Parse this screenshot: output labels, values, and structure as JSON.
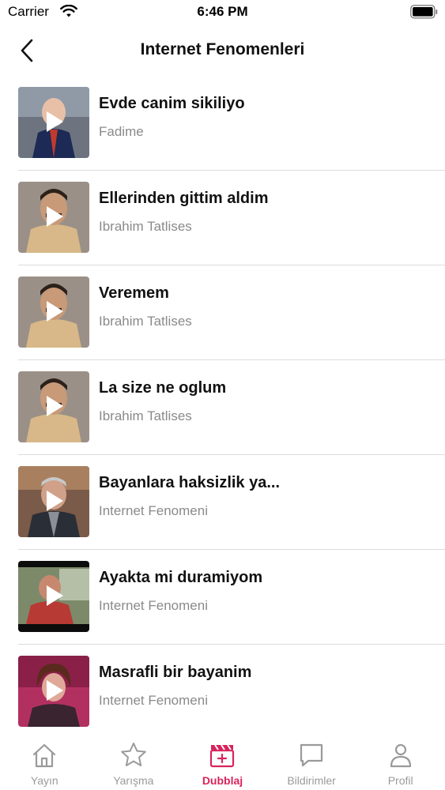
{
  "status": {
    "carrier": "Carrier",
    "time": "6:46 PM"
  },
  "nav": {
    "title": "Internet Fenomenleri"
  },
  "items": [
    {
      "title": "Evde canim sikiliyo",
      "subtitle": "Fadime"
    },
    {
      "title": "Ellerinden gittim aldim",
      "subtitle": "Ibrahim Tatlises"
    },
    {
      "title": "Veremem",
      "subtitle": "Ibrahim Tatlises"
    },
    {
      "title": "La size ne oglum",
      "subtitle": "Ibrahim Tatlises"
    },
    {
      "title": "Bayanlara haksizlik ya...",
      "subtitle": "Internet Fenomeni"
    },
    {
      "title": "Ayakta mi duramiyom",
      "subtitle": "Internet Fenomeni"
    },
    {
      "title": "Masrafli bir bayanim",
      "subtitle": "Internet Fenomeni"
    }
  ],
  "tabs": [
    {
      "label": "Yayın",
      "icon": "home-icon"
    },
    {
      "label": "Yarışma",
      "icon": "star-icon"
    },
    {
      "label": "Dubblaj",
      "icon": "clapperboard-icon",
      "active": true
    },
    {
      "label": "Bildirimler",
      "icon": "chat-bubble-icon"
    },
    {
      "label": "Profil",
      "icon": "person-icon"
    }
  ],
  "colors": {
    "accent": "#d8245c",
    "inactive": "#9a9a9a",
    "subtitle": "#8a8a8a"
  }
}
